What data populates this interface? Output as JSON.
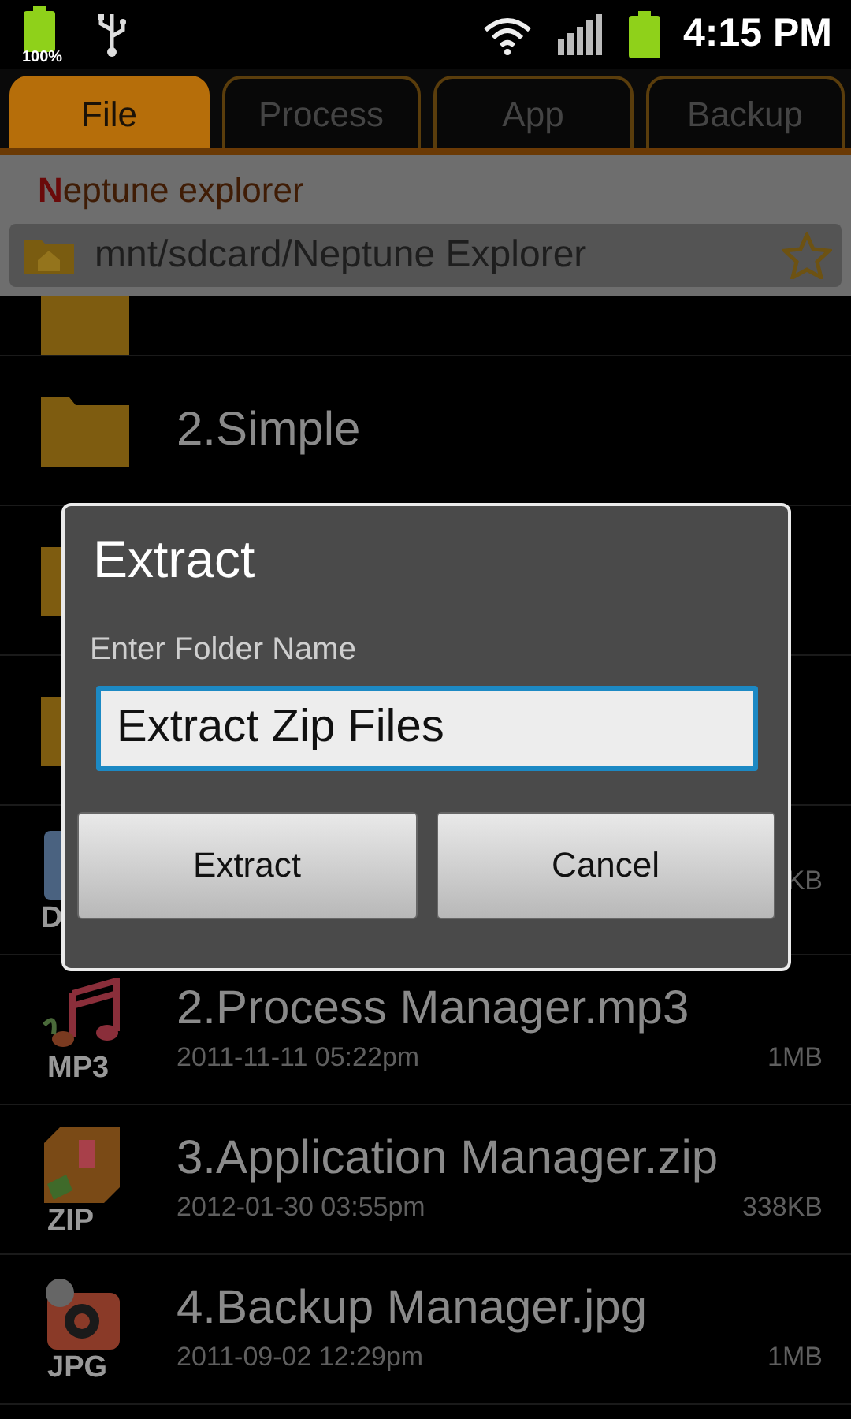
{
  "status_bar": {
    "battery_label": "100%",
    "time": "4:15 PM"
  },
  "tabs": [
    {
      "label": "File",
      "selected": true
    },
    {
      "label": "Process",
      "selected": false
    },
    {
      "label": "App",
      "selected": false
    },
    {
      "label": "Backup",
      "selected": false
    }
  ],
  "app_title": "Neptune explorer",
  "path": "mnt/sdcard/Neptune Explorer",
  "files": [
    {
      "kind": "folder"
    },
    {
      "kind": "folder",
      "name": "2.Simple"
    },
    {
      "kind": "folder"
    },
    {
      "kind": "folder"
    },
    {
      "kind": "doc",
      "type_label": "D",
      "size": "KB"
    },
    {
      "kind": "mp3",
      "type_label": "MP3",
      "name": "2.Process Manager.mp3",
      "date": "2011-11-11 05:22pm",
      "size": "1MB"
    },
    {
      "kind": "zip",
      "type_label": "ZIP",
      "name": "3.Application Manager.zip",
      "date": "2012-01-30 03:55pm",
      "size": "338KB"
    },
    {
      "kind": "jpg",
      "type_label": "JPG",
      "name": "4.Backup Manager.jpg",
      "date": "2011-09-02 12:29pm",
      "size": "1MB"
    }
  ],
  "dialog": {
    "title": "Extract",
    "label": "Enter Folder Name",
    "value": "Extract Zip Files",
    "buttons": [
      "Extract",
      "Cancel"
    ]
  }
}
